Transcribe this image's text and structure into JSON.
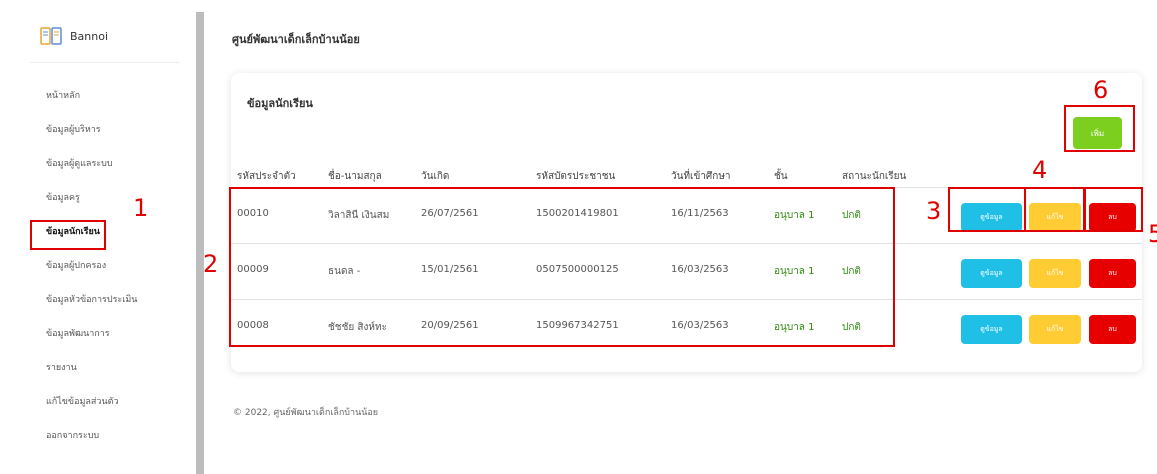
{
  "brand": {
    "name": "Bannoi",
    "icon": "book-icon"
  },
  "header": {
    "title": "ศูนย์พัฒนาเด็กเล็กบ้านน้อย"
  },
  "sidebar": {
    "items": [
      {
        "label": "หน้าหลัก"
      },
      {
        "label": "ข้อมูลผู้บริหาร"
      },
      {
        "label": "ข้อมูลผู้ดูแลระบบ"
      },
      {
        "label": "ข้อมูลครู"
      },
      {
        "label": "ข้อมูลนักเรียน"
      },
      {
        "label": "ข้อมูลผู้ปกครอง"
      },
      {
        "label": "ข้อมูลหัวข้อการประเมิน"
      },
      {
        "label": "ข้อมูลพัฒนาการ"
      },
      {
        "label": "รายงาน"
      },
      {
        "label": "แก้ไขข้อมูลส่วนตัว"
      },
      {
        "label": "ออกจากระบบ"
      }
    ]
  },
  "card": {
    "title": "ข้อมูลนักเรียน",
    "add_label": "เพิ่ม",
    "columns": [
      "รหัสประจำตัว",
      "ชื่อ-นามสกุล",
      "วันเกิด",
      "รหัสบัตรประชาชน",
      "วันที่เข้าศึกษา",
      "ชั้น",
      "สถานะนักเรียน"
    ],
    "rows": [
      {
        "id": "00010",
        "name": "วิลาสินี เงินสม",
        "dob": "26/07/2561",
        "citizen_id": "1500201419801",
        "enrolled": "16/11/2563",
        "grade": "อนุบาล 1",
        "status": "ปกติ"
      },
      {
        "id": "00009",
        "name": "ธนดล -",
        "dob": "15/01/2561",
        "citizen_id": "0507500000125",
        "enrolled": "16/03/2563",
        "grade": "อนุบาล 1",
        "status": "ปกติ"
      },
      {
        "id": "00008",
        "name": "ชัชชัย สิงห์ทะ",
        "dob": "20/09/2561",
        "citizen_id": "1509967342751",
        "enrolled": "16/03/2563",
        "grade": "อนุบาล 1",
        "status": "ปกติ"
      }
    ],
    "info_label": "ดูข้อมูล",
    "edit_label": "แก้ไข",
    "delete_label": "ลบ"
  },
  "annotations": {
    "n1": "1",
    "n2": "2",
    "n3": "3",
    "n4": "4",
    "n5": "5",
    "n6": "6",
    "color": "#e00000"
  },
  "footer": {
    "text": "© 2022, ศูนย์พัฒนาเด็กเล็กบ้านน้อย"
  }
}
